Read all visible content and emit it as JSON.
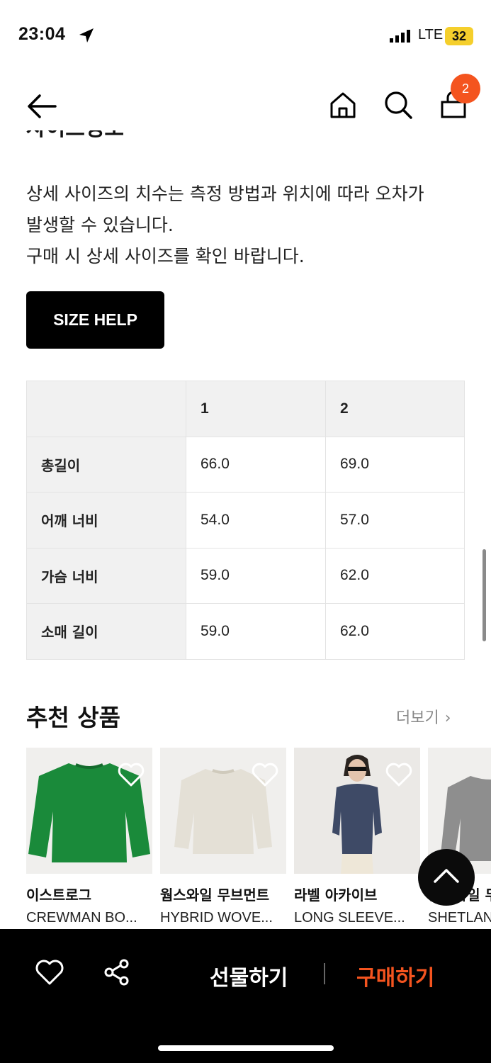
{
  "status_bar": {
    "time": "23:04",
    "network": "LTE",
    "battery": "32"
  },
  "header": {
    "cart_count": "2"
  },
  "size_info": {
    "heading": "사이즈정보",
    "notice_lines": [
      "상세 사이즈의 치수는 측정 방법과 위치에 따라 오차가",
      "발생할 수 있습니다.",
      "구매 시 상세 사이즈를 확인 바랍니다."
    ],
    "help_button": "SIZE HELP",
    "columns": [
      "",
      "1",
      "2"
    ],
    "rows": [
      {
        "label": "총길이",
        "values": [
          "66.0",
          "69.0"
        ]
      },
      {
        "label": "어깨 너비",
        "values": [
          "54.0",
          "57.0"
        ]
      },
      {
        "label": "가슴 너비",
        "values": [
          "59.0",
          "62.0"
        ]
      },
      {
        "label": "소매 길이",
        "values": [
          "59.0",
          "62.0"
        ]
      }
    ]
  },
  "recommended": {
    "title": "추천 상품",
    "more": "더보기",
    "products": [
      {
        "brand": "이스트로그",
        "name": "CREWMAN BO...",
        "color": "#1a8a3a"
      },
      {
        "brand": "웜스와일 무브먼트",
        "name": "HYBRID WOVE...",
        "color": "#ece8df"
      },
      {
        "brand": "라벨 아카이브",
        "name": "LONG SLEEVE...",
        "color": "#3e4a66"
      },
      {
        "brand": "웜스와일 무",
        "name": "SHETLAND",
        "color": "#8e8e8e"
      }
    ]
  },
  "bottom_bar": {
    "gift": "선물하기",
    "buy": "구매하기"
  },
  "colors": {
    "accent": "#f4541f",
    "bar": "#000000"
  }
}
